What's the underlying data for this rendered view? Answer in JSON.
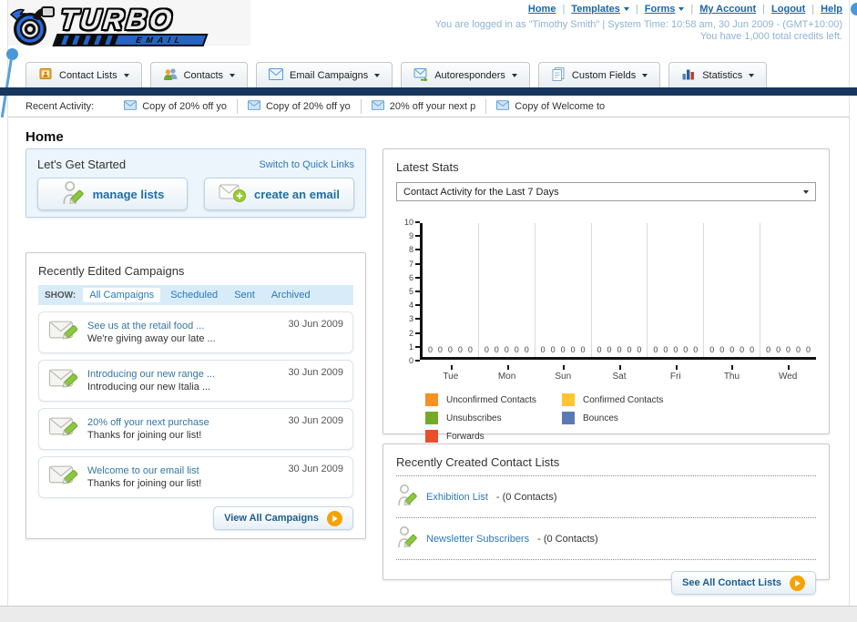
{
  "header": {
    "logo": {
      "name": "TURBO",
      "sub": "EMAIL"
    },
    "nav": {
      "items": [
        {
          "label": "Home",
          "dropdown": false
        },
        {
          "label": "Templates",
          "dropdown": true
        },
        {
          "label": "Forms",
          "dropdown": true
        },
        {
          "label": "My Account",
          "dropdown": false
        },
        {
          "label": "Logout",
          "dropdown": false
        },
        {
          "label": "Help",
          "dropdown": false
        }
      ]
    },
    "login_info": "You are logged in as \"Timothy Smith\" | System Time: 10:58 am, 30 Jun 2009 - (GMT+10:00)",
    "credits_info": "You have 1,000 total credits left."
  },
  "nav_tabs": [
    {
      "label": "Contact Lists",
      "icon": "contact-lists-icon"
    },
    {
      "label": "Contacts",
      "icon": "contacts-icon"
    },
    {
      "label": "Email Campaigns",
      "icon": "email-campaigns-icon"
    },
    {
      "label": "Autoresponders",
      "icon": "autoresponders-icon"
    },
    {
      "label": "Custom Fields",
      "icon": "custom-fields-icon"
    },
    {
      "label": "Statistics",
      "icon": "statistics-icon"
    }
  ],
  "recent_activity": {
    "label": "Recent Activity:",
    "items": [
      "Copy of 20% off yo",
      "Copy of 20% off yo",
      "20% off your next p",
      "Copy of Welcome to"
    ]
  },
  "page_title": "Home",
  "get_started": {
    "title": "Let's Get Started",
    "switch_link": "Switch to Quick Links",
    "manage_lists_label": "manage lists",
    "create_email_label": "create an email"
  },
  "campaigns_panel": {
    "title": "Recently Edited Campaigns",
    "show_label": "SHOW:",
    "filters": [
      "All Campaigns",
      "Scheduled",
      "Sent",
      "Archived"
    ],
    "active_filter": "All Campaigns",
    "items": [
      {
        "title": "See us at the retail food ...",
        "subtitle": "We're giving away our late ...",
        "date": "30 Jun 2009"
      },
      {
        "title": "Introducing our new range ...",
        "subtitle": "Introducing our new Italia ...",
        "date": "30 Jun 2009"
      },
      {
        "title": "20% off your next purchase",
        "subtitle": "Thanks for joining our list!",
        "date": "30 Jun 2009"
      },
      {
        "title": "Welcome to our email list",
        "subtitle": "Thanks for joining our list!",
        "date": "30 Jun 2009"
      }
    ],
    "view_all_label": "View All Campaigns"
  },
  "stats_panel": {
    "title": "Latest Stats",
    "period_selected": "Contact Activity for the Last 7 Days",
    "chart_data": {
      "type": "bar",
      "title": "Contact Activity for the Last 7 Days",
      "categories": [
        "Tue",
        "Mon",
        "Sun",
        "Sat",
        "Fri",
        "Thu",
        "Wed"
      ],
      "series": [
        {
          "name": "Unconfirmed Contacts",
          "color": "#f79122",
          "values": [
            0,
            0,
            0,
            0,
            0,
            0,
            0
          ]
        },
        {
          "name": "Confirmed Contacts",
          "color": "#fdc62f",
          "values": [
            0,
            0,
            0,
            0,
            0,
            0,
            0
          ]
        },
        {
          "name": "Unsubscribes",
          "color": "#74aa28",
          "values": [
            0,
            0,
            0,
            0,
            0,
            0,
            0
          ]
        },
        {
          "name": "Bounces",
          "color": "#5b7ab5",
          "values": [
            0,
            0,
            0,
            0,
            0,
            0,
            0
          ]
        },
        {
          "name": "Forwards",
          "color": "#e8502d",
          "values": [
            0,
            0,
            0,
            0,
            0,
            0,
            0
          ]
        }
      ],
      "ylim": [
        0,
        10
      ],
      "grid": "vertical-day-separators",
      "legend_position": "bottom"
    }
  },
  "contact_lists_panel": {
    "title": "Recently Created Contact Lists",
    "items": [
      {
        "name": "Exhibition List",
        "suffix": "- (0 Contacts)"
      },
      {
        "name": "Newsletter Subscribers",
        "suffix": "- (0 Contacts)"
      }
    ],
    "see_all_label": "See All Contact Lists"
  }
}
